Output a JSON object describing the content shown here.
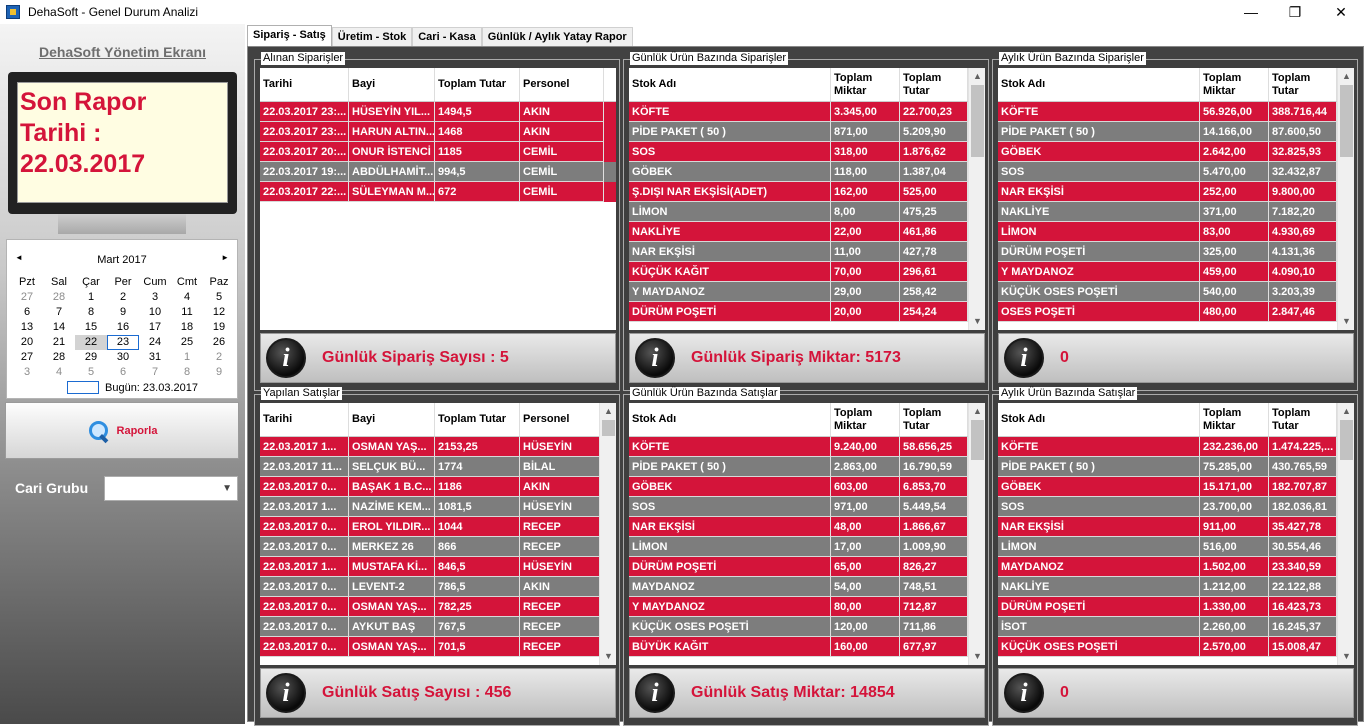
{
  "window": {
    "title": "DehaSoft - Genel Durum Analizi",
    "minimize": "—",
    "maximize": "❐",
    "close": "✕"
  },
  "sidebar": {
    "heading": "DehaSoft Yönetim Ekranı",
    "monitor_lines": [
      "Son Rapor",
      "Tarihi :",
      "22.03.2017"
    ],
    "calendar": {
      "month": "Mart 2017",
      "prev": "◄",
      "next": "►",
      "weekdays": [
        "Pzt",
        "Sal",
        "Çar",
        "Per",
        "Cum",
        "Cmt",
        "Paz"
      ],
      "days": [
        [
          "27",
          "28",
          "1",
          "2",
          "3",
          "4",
          "5"
        ],
        [
          "6",
          "7",
          "8",
          "9",
          "10",
          "11",
          "12"
        ],
        [
          "13",
          "14",
          "15",
          "16",
          "17",
          "18",
          "19"
        ],
        [
          "20",
          "21",
          "22",
          "23",
          "24",
          "25",
          "26"
        ],
        [
          "27",
          "28",
          "29",
          "30",
          "31",
          "1",
          "2"
        ],
        [
          "3",
          "4",
          "5",
          "6",
          "7",
          "8",
          "9"
        ]
      ],
      "today_label": "Bugün: 23.03.2017"
    },
    "report_button": "Raporla",
    "cari_label": "Cari Grubu",
    "cari_value": ""
  },
  "tabs": [
    "Sipariş - Satış",
    "Üretim - Stok",
    "Cari - Kasa",
    "Günlük / Aylık Yatay Rapor"
  ],
  "colors": {
    "red_row": "#d4143a",
    "gray_row": "#7d7d7d",
    "accent_text": "#d4143a"
  },
  "panels": [
    {
      "title": "Alınan Siparişler",
      "columns": [
        "Tarihi",
        "Bayi",
        "Toplam Tutar",
        "Personel"
      ],
      "rows": [
        [
          "22.03.2017 23:...",
          "HÜSEYİN  YIL...",
          "1494,5",
          "AKIN"
        ],
        [
          "22.03.2017 23:...",
          "HARUN ALTIN...",
          "1468",
          "AKIN"
        ],
        [
          "22.03.2017 20:...",
          "ONUR İSTENCİ",
          "1185",
          "CEMİL"
        ],
        [
          "22.03.2017 19:...",
          "ABDÜLHAMİT...",
          "994,5",
          "CEMİL"
        ],
        [
          "22.03.2017 22:...",
          "SÜLEYMAN M...",
          "672",
          "CEMİL"
        ]
      ],
      "row_colors": [
        "r",
        "r",
        "r",
        "g",
        "r"
      ],
      "footer": "Günlük Sipariş Sayısı : 5"
    },
    {
      "title": "Günlük Ürün Bazında Siparişler",
      "columns": [
        "Stok Adı",
        "Toplam Miktar",
        "Toplam Tutar"
      ],
      "rows": [
        [
          "KÖFTE",
          "3.345,00",
          "22.700,23"
        ],
        [
          "PİDE PAKET ( 50 )",
          "871,00",
          "5.209,90"
        ],
        [
          "SOS",
          "318,00",
          "1.876,62"
        ],
        [
          "GÖBEK",
          "118,00",
          "1.387,04"
        ],
        [
          "Ş.DIŞI NAR EKŞİSİ(ADET)",
          "162,00",
          "525,00"
        ],
        [
          "LİMON",
          "8,00",
          "475,25"
        ],
        [
          "NAKLİYE",
          "22,00",
          "461,86"
        ],
        [
          "NAR EKŞİSİ",
          "11,00",
          "427,78"
        ],
        [
          "KÜÇÜK KAĞIT",
          "70,00",
          "296,61"
        ],
        [
          "Y MAYDANOZ",
          "29,00",
          "258,42"
        ],
        [
          "DÜRÜM POŞETİ",
          "20,00",
          "254,24"
        ]
      ],
      "row_colors": [
        "r",
        "g",
        "r",
        "g",
        "r",
        "g",
        "r",
        "g",
        "r",
        "g",
        "r"
      ],
      "footer": "Günlük Sipariş Miktar: 5173"
    },
    {
      "title": "Aylık Ürün Bazında Siparişler",
      "columns": [
        "Stok Adı",
        "Toplam Miktar",
        "Toplam Tutar"
      ],
      "rows": [
        [
          "KÖFTE",
          "56.926,00",
          "388.716,44"
        ],
        [
          "PİDE PAKET ( 50 )",
          "14.166,00",
          "87.600,50"
        ],
        [
          "GÖBEK",
          "2.642,00",
          "32.825,93"
        ],
        [
          "SOS",
          "5.470,00",
          "32.432,87"
        ],
        [
          "NAR EKŞİSİ",
          "252,00",
          "9.800,00"
        ],
        [
          "NAKLİYE",
          "371,00",
          "7.182,20"
        ],
        [
          "LİMON",
          "83,00",
          "4.930,69"
        ],
        [
          "DÜRÜM POŞETİ",
          "325,00",
          "4.131,36"
        ],
        [
          "Y MAYDANOZ",
          "459,00",
          "4.090,10"
        ],
        [
          "KÜÇÜK OSES POŞETİ",
          "540,00",
          "3.203,39"
        ],
        [
          "OSES POŞETİ",
          "480,00",
          "2.847,46"
        ]
      ],
      "row_colors": [
        "r",
        "g",
        "r",
        "g",
        "r",
        "g",
        "r",
        "g",
        "r",
        "g",
        "r"
      ],
      "footer": "0"
    },
    {
      "title": "Yapılan Satışlar",
      "columns": [
        "Tarihi",
        "Bayi",
        "Toplam Tutar",
        "Personel"
      ],
      "rows": [
        [
          "22.03.2017 1...",
          "OSMAN YAŞ...",
          "2153,25",
          "HÜSEYİN"
        ],
        [
          "22.03.2017 11...",
          "SELÇUK  BÜ...",
          "1774",
          "BİLAL"
        ],
        [
          "22.03.2017 0...",
          "BAŞAK 1 B.C...",
          "1186",
          "AKIN"
        ],
        [
          "22.03.2017 1...",
          "NAZİME KEM...",
          "1081,5",
          "HÜSEYİN"
        ],
        [
          "22.03.2017 0...",
          "EROL YILDIR...",
          "1044",
          "RECEP"
        ],
        [
          "22.03.2017 0...",
          "MERKEZ 26",
          "866",
          "RECEP"
        ],
        [
          "22.03.2017 1...",
          "MUSTAFA Kİ...",
          "846,5",
          "HÜSEYİN"
        ],
        [
          "22.03.2017 0...",
          "LEVENT-2",
          "786,5",
          "AKIN"
        ],
        [
          "22.03.2017 0...",
          "OSMAN YAŞ...",
          "782,25",
          "RECEP"
        ],
        [
          "22.03.2017 0...",
          "AYKUT BAŞ",
          "767,5",
          "RECEP"
        ],
        [
          "22.03.2017 0...",
          "OSMAN  YAŞ...",
          "701,5",
          "RECEP"
        ]
      ],
      "row_colors": [
        "r",
        "g",
        "r",
        "g",
        "r",
        "g",
        "r",
        "g",
        "r",
        "g",
        "r"
      ],
      "footer": "Günlük Satış Sayısı : 456"
    },
    {
      "title": "Günlük Ürün Bazında Satışlar",
      "columns": [
        "Stok Adı",
        "Toplam Miktar",
        "Toplam Tutar"
      ],
      "rows": [
        [
          "KÖFTE",
          "9.240,00",
          "58.656,25"
        ],
        [
          "PİDE PAKET ( 50 )",
          "2.863,00",
          "16.790,59"
        ],
        [
          "GÖBEK",
          "603,00",
          "6.853,70"
        ],
        [
          "SOS",
          "971,00",
          "5.449,54"
        ],
        [
          "NAR EKŞİSİ",
          "48,00",
          "1.866,67"
        ],
        [
          "LİMON",
          "17,00",
          "1.009,90"
        ],
        [
          "DÜRÜM POŞETİ",
          "65,00",
          "826,27"
        ],
        [
          "MAYDANOZ",
          "54,00",
          "748,51"
        ],
        [
          "Y MAYDANOZ",
          "80,00",
          "712,87"
        ],
        [
          "KÜÇÜK OSES POŞETİ",
          "120,00",
          "711,86"
        ],
        [
          "BÜYÜK KAĞIT",
          "160,00",
          "677,97"
        ]
      ],
      "row_colors": [
        "r",
        "g",
        "r",
        "g",
        "r",
        "g",
        "r",
        "g",
        "r",
        "g",
        "r"
      ],
      "footer": "Günlük Satış Miktar: 14854"
    },
    {
      "title": "Aylık Ürün Bazında Satışlar",
      "columns": [
        "Stok Adı",
        "Toplam Miktar",
        "Toplam Tutar"
      ],
      "rows": [
        [
          "KÖFTE",
          "232.236,00",
          "1.474.225,..."
        ],
        [
          "PİDE PAKET ( 50 )",
          "75.285,00",
          "430.765,59"
        ],
        [
          "GÖBEK",
          "15.171,00",
          "182.707,87"
        ],
        [
          "SOS",
          "23.700,00",
          "182.036,81"
        ],
        [
          "NAR EKŞİSİ",
          "911,00",
          "35.427,78"
        ],
        [
          "LİMON",
          "516,00",
          "30.554,46"
        ],
        [
          "MAYDANOZ",
          "1.502,00",
          "23.340,59"
        ],
        [
          "NAKLİYE",
          "1.212,00",
          "22.122,88"
        ],
        [
          "DÜRÜM POŞETİ",
          "1.330,00",
          "16.423,73"
        ],
        [
          "İSOT",
          "2.260,00",
          "16.245,37"
        ],
        [
          "KÜÇÜK OSES POŞETİ",
          "2.570,00",
          "15.008,47"
        ]
      ],
      "row_colors": [
        "r",
        "g",
        "r",
        "g",
        "r",
        "g",
        "r",
        "g",
        "r",
        "g",
        "r"
      ],
      "footer": "0"
    }
  ]
}
